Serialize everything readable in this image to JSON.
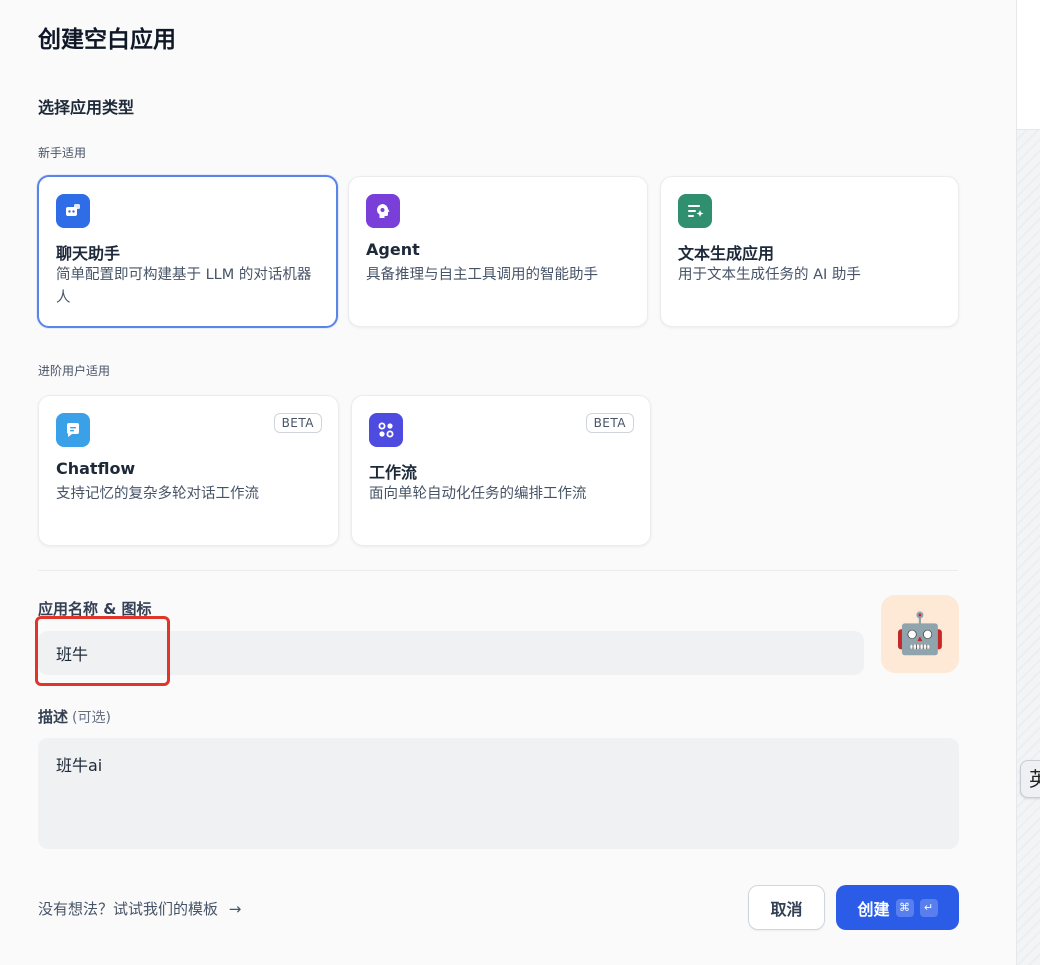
{
  "dialog": {
    "title": "创建空白应用",
    "section_title": "选择应用类型",
    "group_beginner": "新手适用",
    "group_advanced": "进阶用户适用"
  },
  "cards": [
    {
      "title": "聊天助手",
      "desc": "简单配置即可构建基于 LLM 的对话机器人",
      "icon": "chat-bot-icon",
      "color": "#2e6ce8",
      "selected": true
    },
    {
      "title": "Agent",
      "desc": "具备推理与自主工具调用的智能助手",
      "icon": "agent-brain-icon",
      "color": "#7a3fd9"
    },
    {
      "title": "文本生成应用",
      "desc": "用于文本生成任务的 AI 助手",
      "icon": "text-generation-icon",
      "color": "#2f8f6f"
    },
    {
      "title": "Chatflow",
      "desc": "支持记忆的复杂多轮对话工作流",
      "icon": "chatflow-icon",
      "color": "#3aa0e8",
      "badge": "BETA"
    },
    {
      "title": "工作流",
      "desc": "面向单轮自动化任务的编排工作流",
      "icon": "workflow-icon",
      "color": "#4e4be0",
      "badge": "BETA"
    }
  ],
  "form": {
    "name_label": "应用名称 & 图标",
    "name_value": "班牛",
    "avatar_emoji": "🤖",
    "desc_label": "描述",
    "desc_optional": "(可选)",
    "desc_value": "班牛ai"
  },
  "footer": {
    "template_link": "没有想法？试试我们的模板",
    "template_arrow": "→",
    "cancel_label": "取消",
    "create_label": "创建",
    "shortcut_cmd": "⌘",
    "shortcut_enter": "↵"
  },
  "ime_indicator": "英"
}
